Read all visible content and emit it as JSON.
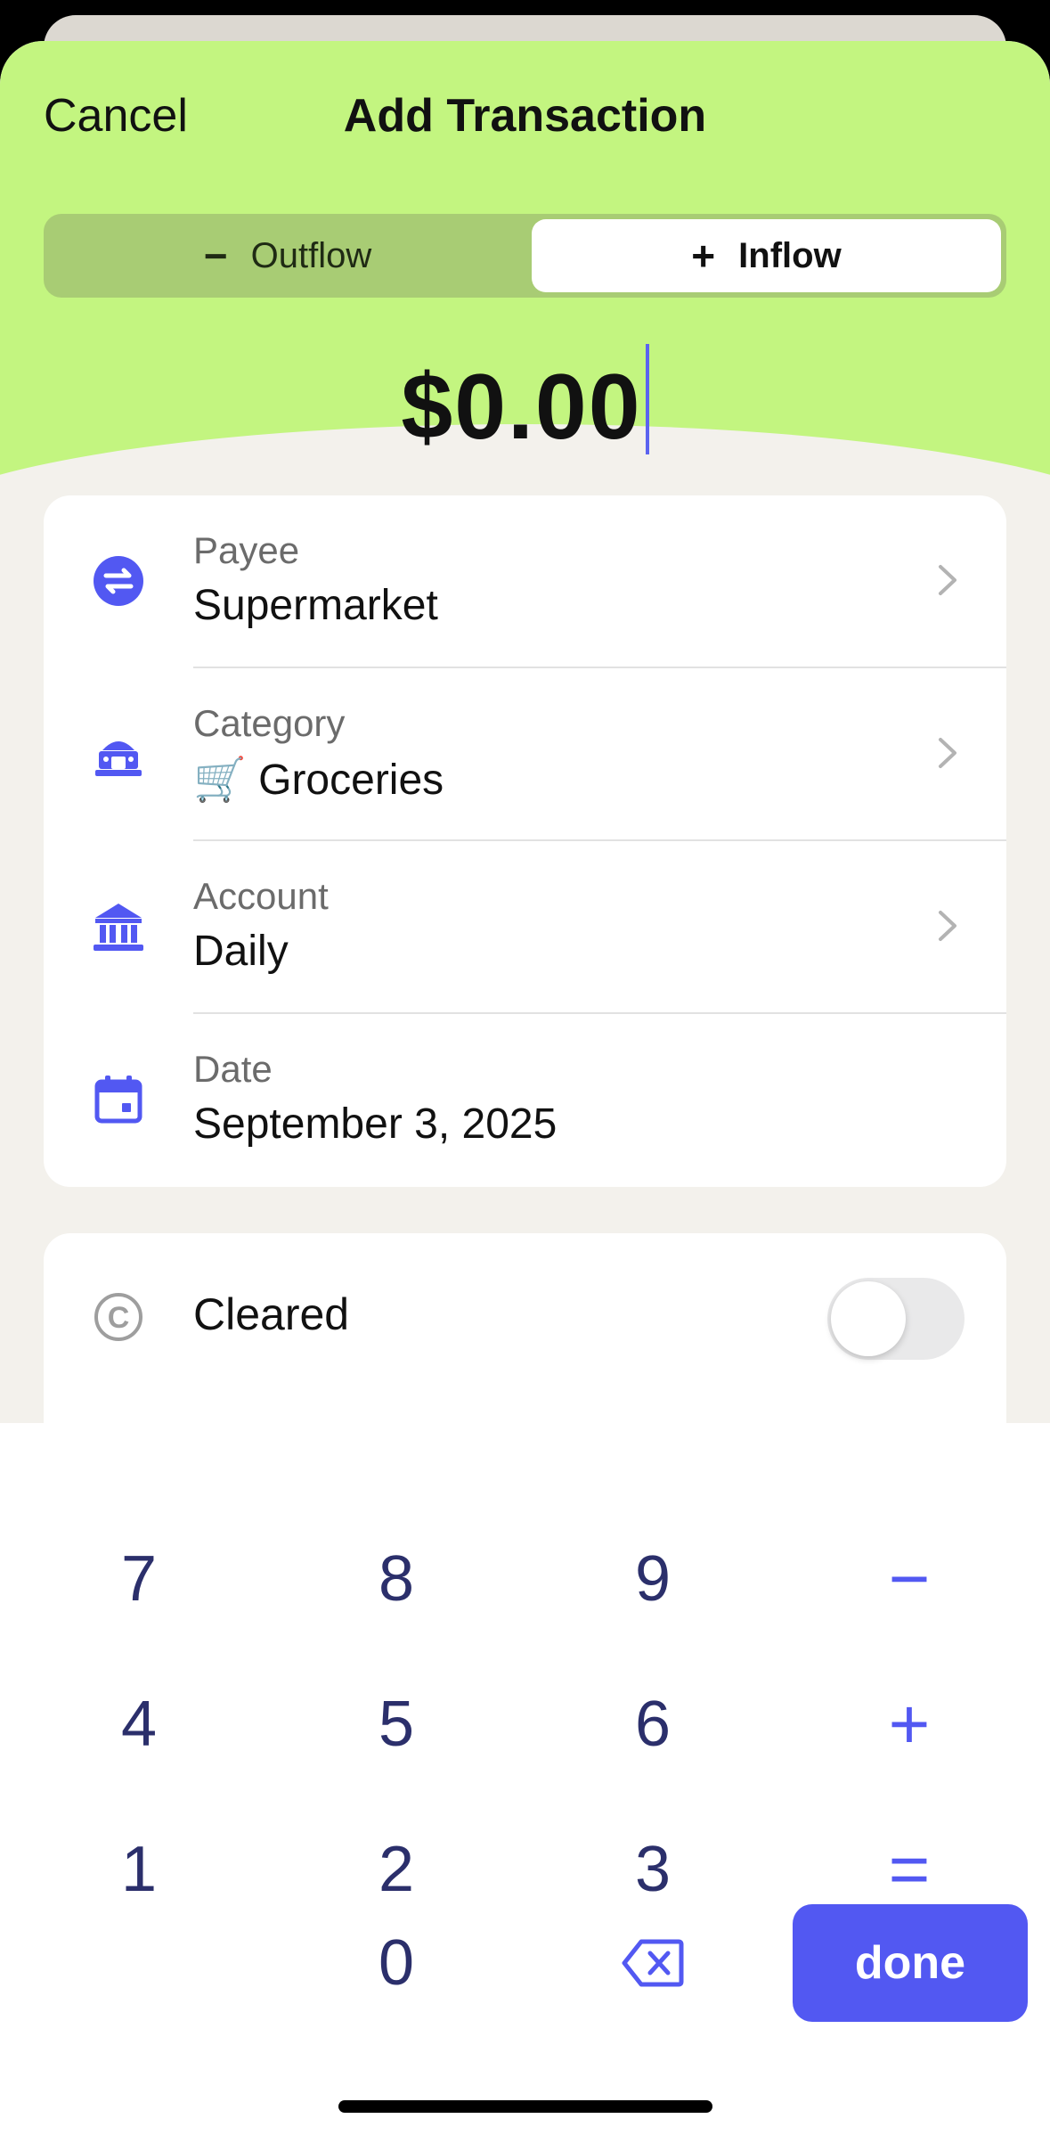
{
  "colors": {
    "hero_bg": "#c3f580",
    "segmented_bg": "#a8cc74",
    "accent": "#5258f2",
    "key_digit": "#2b2f6b",
    "sheet_bg": "#f3f1ec"
  },
  "header": {
    "cancel_label": "Cancel",
    "title": "Add Transaction"
  },
  "segmented": {
    "outflow_label": "Outflow",
    "outflow_icon": "minus-icon",
    "inflow_label": "Inflow",
    "inflow_icon": "plus-icon",
    "selected": "Inflow"
  },
  "amount": "$0.00",
  "details": [
    {
      "icon": "transfer-icon",
      "label": "Payee",
      "value": "Supermarket",
      "chevron": true
    },
    {
      "icon": "category-icon",
      "label": "Category",
      "value": "🛒 Groceries",
      "chevron": true
    },
    {
      "icon": "bank-icon",
      "label": "Account",
      "value": "Daily",
      "chevron": true
    },
    {
      "icon": "calendar-icon",
      "label": "Date",
      "value": "September 3, 2025",
      "chevron": false
    }
  ],
  "cleared": {
    "icon": "cleared-icon",
    "label": "Cleared",
    "on": false
  },
  "keypad": {
    "digits": [
      "7",
      "8",
      "9",
      "4",
      "5",
      "6",
      "1",
      "2",
      "3",
      "0"
    ],
    "minus": "−",
    "plus": "+",
    "equals": "=",
    "backspace_icon": "backspace-icon",
    "done_label": "done"
  }
}
